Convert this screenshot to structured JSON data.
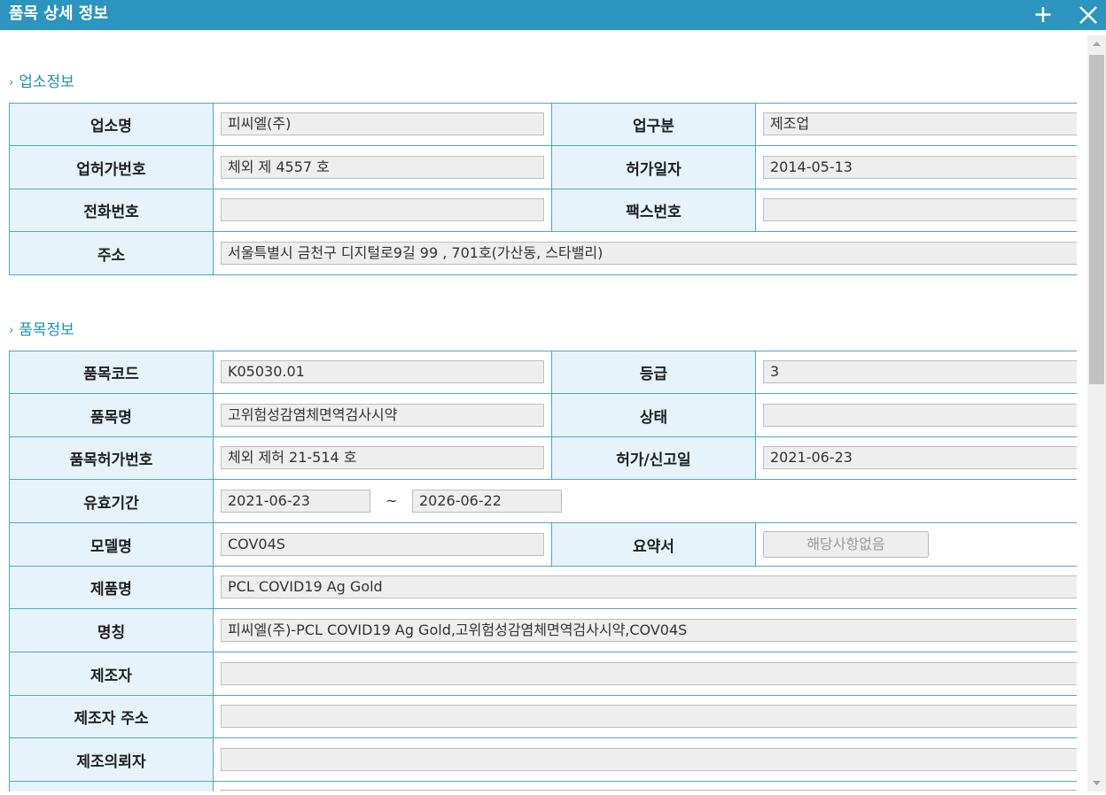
{
  "window": {
    "title": "품목 상세 정보"
  },
  "business": {
    "section_title": "업소정보",
    "name_label": "업소명",
    "name_value": "피씨엘(주)",
    "category_label": "업구분",
    "category_value": "제조업",
    "license_no_label": "업허가번호",
    "license_no_value": "체외 제 4557 호",
    "license_date_label": "허가일자",
    "license_date_value": "2014-05-13",
    "phone_label": "전화번호",
    "phone_value": "",
    "fax_label": "팩스번호",
    "fax_value": "",
    "address_label": "주소",
    "address_value": "서울특별시 금천구 디지털로9길 99 , 701호(가산동, 스타밸리)"
  },
  "product": {
    "section_title": "품목정보",
    "code_label": "품목코드",
    "code_value": "K05030.01",
    "grade_label": "등급",
    "grade_value": "3",
    "name_label": "품목명",
    "name_value": "고위험성감염체면역검사시약",
    "status_label": "상태",
    "status_value": "",
    "permit_no_label": "품목허가번호",
    "permit_no_value": "체외 제허 21-514 호",
    "permit_date_label": "허가/신고일",
    "permit_date_value": "2021-06-23",
    "validity_label": "유효기간",
    "validity_from": "2021-06-23",
    "validity_sep": "~",
    "validity_to": "2026-06-22",
    "model_label": "모델명",
    "model_value": "COV04S",
    "summary_label": "요약서",
    "summary_button": "해당사항없음",
    "product_name_label": "제품명",
    "product_name_value": "PCL COVID19 Ag Gold",
    "designation_label": "명칭",
    "designation_value": "피씨엘(주)-PCL COVID19 Ag Gold,고위험성감염체면역검사시약,COV04S",
    "manufacturer_label": "제조자",
    "manufacturer_value": "",
    "manufacturer_address_label": "제조자 주소",
    "manufacturer_address_value": "",
    "consignor_label": "제조의뢰자",
    "consignor_value": ""
  }
}
